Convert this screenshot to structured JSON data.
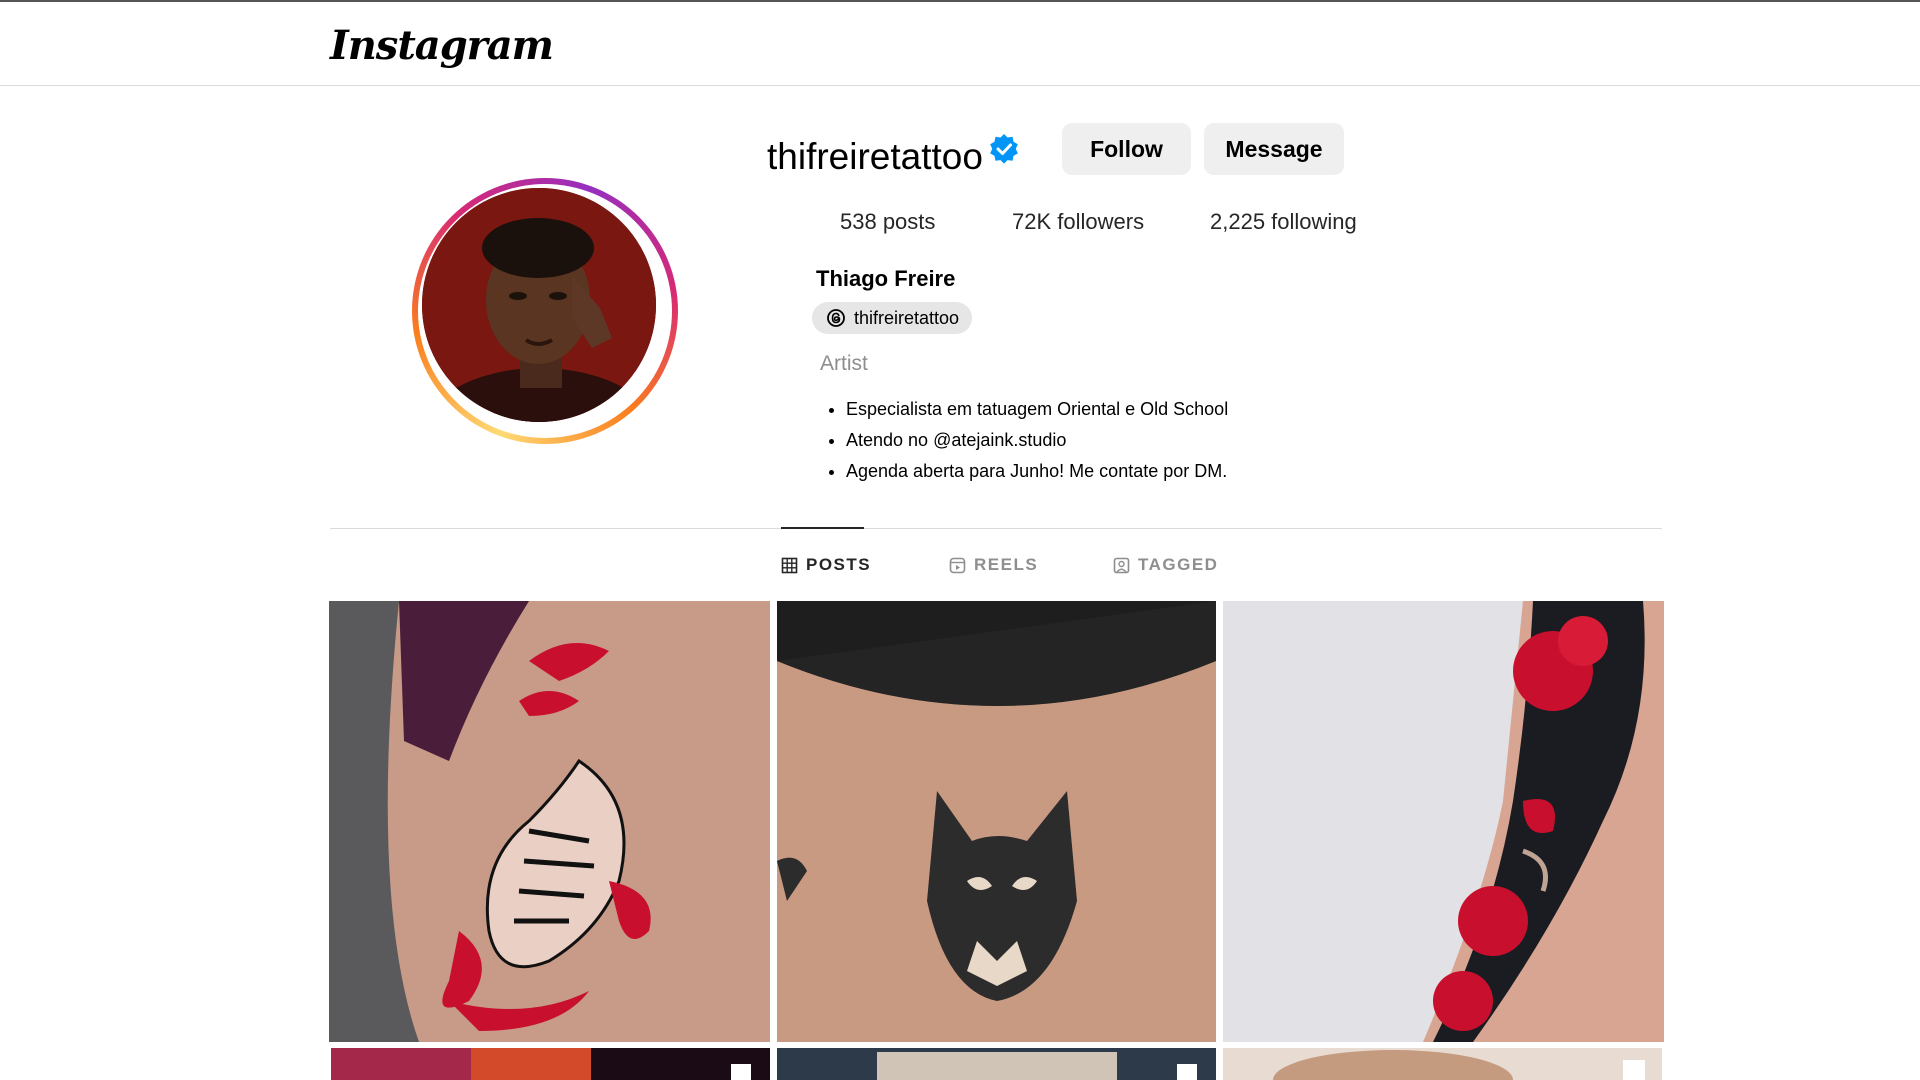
{
  "header": {
    "logo_text": "Instagram"
  },
  "profile": {
    "username": "thifreiretattoo",
    "verified": true,
    "follow_label": "Follow",
    "message_label": "Message",
    "stats": {
      "posts": "538 posts",
      "followers": "72K followers",
      "following": "2,225 following"
    },
    "full_name": "Thiago Freire",
    "threads_handle": "thifreiretattoo",
    "category": "Artist",
    "bio": [
      "Especialista em tatuagem Oriental e Old School",
      "Atendo no @atejaink.studio",
      "Agenda aberta para Junho! Me contate por DM."
    ]
  },
  "tabs": [
    {
      "label": "POSTS",
      "active": true,
      "icon": "grid-icon"
    },
    {
      "label": "REELS",
      "active": false,
      "icon": "reels-icon"
    },
    {
      "label": "TAGGED",
      "active": false,
      "icon": "tagged-icon"
    }
  ],
  "colors": {
    "verified_blue": "#0095f6",
    "button_bg": "#efefef",
    "tattoo_red": "#c8102e"
  }
}
